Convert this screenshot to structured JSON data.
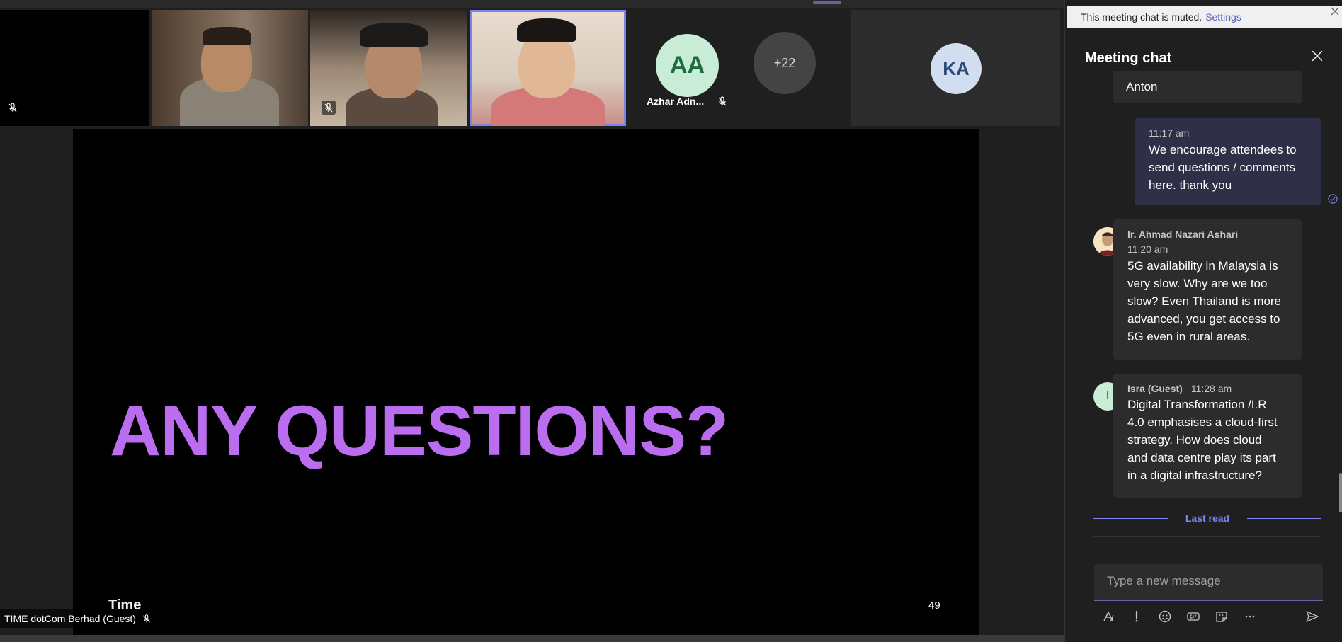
{
  "participants": {
    "tiles": [
      {
        "name": "",
        "muted": true
      },
      {
        "name": "",
        "muted": false
      },
      {
        "name": "",
        "muted": true
      },
      {
        "name": "",
        "muted": false,
        "active": true
      },
      {
        "initials": "AA",
        "name": "Azhar Adn...",
        "muted": true
      },
      {
        "overflow_label": "+22"
      },
      {
        "initials": "KA"
      }
    ]
  },
  "slide": {
    "heading": "ANY QUESTIONS?",
    "logo_text": "Time",
    "page_number": "49",
    "presenter_label": "TIME dotCom Berhad (Guest)"
  },
  "chat": {
    "muted_notice": "This meeting chat is muted.",
    "settings_link": "Settings",
    "title": "Meeting chat",
    "messages": [
      {
        "author": "",
        "time": "",
        "text": "Anton",
        "direction": "in"
      },
      {
        "author": "",
        "time": "11:17 am",
        "text_lines": [
          "We encourage attendees to",
          "send questions / comments",
          "here. thank you"
        ],
        "direction": "out"
      },
      {
        "author": "Ir. Ahmad Nazari Ashari",
        "time": "11:20 am",
        "text_lines": [
          "5G availability in Malaysia is",
          "very slow. Why are we too",
          "slow? Even Thailand is more",
          "advanced, you get access to",
          "5G even in rural areas."
        ],
        "direction": "in"
      },
      {
        "author": "Isra (Guest)",
        "initial": "I",
        "time": "11:28 am",
        "text_lines": [
          "Digital Transformation /I.R",
          "4.0 emphasises a cloud-first",
          "strategy.  How does cloud",
          "and data centre play its part",
          "in a digital infrastructure?"
        ],
        "direction": "in"
      }
    ],
    "last_read_label": "Last read",
    "compose_placeholder": "Type a new message"
  },
  "colors": {
    "accent": "#6264a7",
    "slide_heading": "#bb6df0",
    "chat_bg": "#1f1f1f",
    "own_bubble": "#2f3047"
  },
  "icons": [
    "mic-off-icon",
    "close-icon",
    "format-icon",
    "priority-icon",
    "emoji-icon",
    "gif-icon",
    "sticker-icon",
    "more-icon",
    "send-icon",
    "read-receipt-icon"
  ]
}
